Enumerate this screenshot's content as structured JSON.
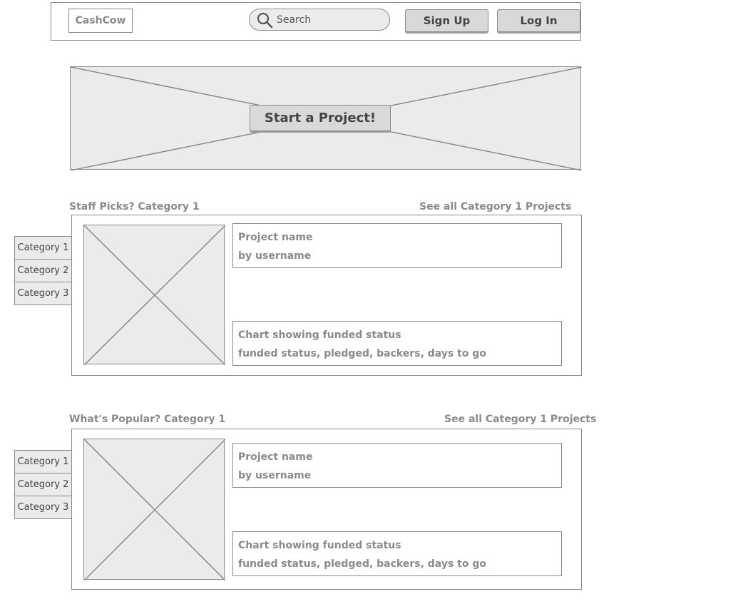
{
  "header": {
    "logo": "CashCow",
    "search_placeholder": "Search",
    "signup_label": "Sign Up",
    "login_label": "Log In"
  },
  "hero": {
    "cta_label": "Start a Project!"
  },
  "sections": [
    {
      "title": "Staff Picks? Category 1",
      "see_all": "See all Category 1 Projects",
      "categories": [
        "Category 1",
        "Category 2",
        "Category 3"
      ],
      "project": {
        "name": "Project name",
        "byline": "by username",
        "chart_title": "Chart showing funded status",
        "chart_details": "funded status, pledged, backers, days to go"
      }
    },
    {
      "title": "What's Popular? Category 1",
      "see_all": "See all Category 1 Projects",
      "categories": [
        "Category 1",
        "Category 2",
        "Category 3"
      ],
      "project": {
        "name": "Project name",
        "byline": "by username",
        "chart_title": "Chart showing funded status",
        "chart_details": "funded status, pledged, backers, days to go"
      }
    }
  ],
  "colors": {
    "border": "#8a8a8a",
    "placeholder_fill": "#ebebeb",
    "button_fill": "#d9d9d9"
  }
}
